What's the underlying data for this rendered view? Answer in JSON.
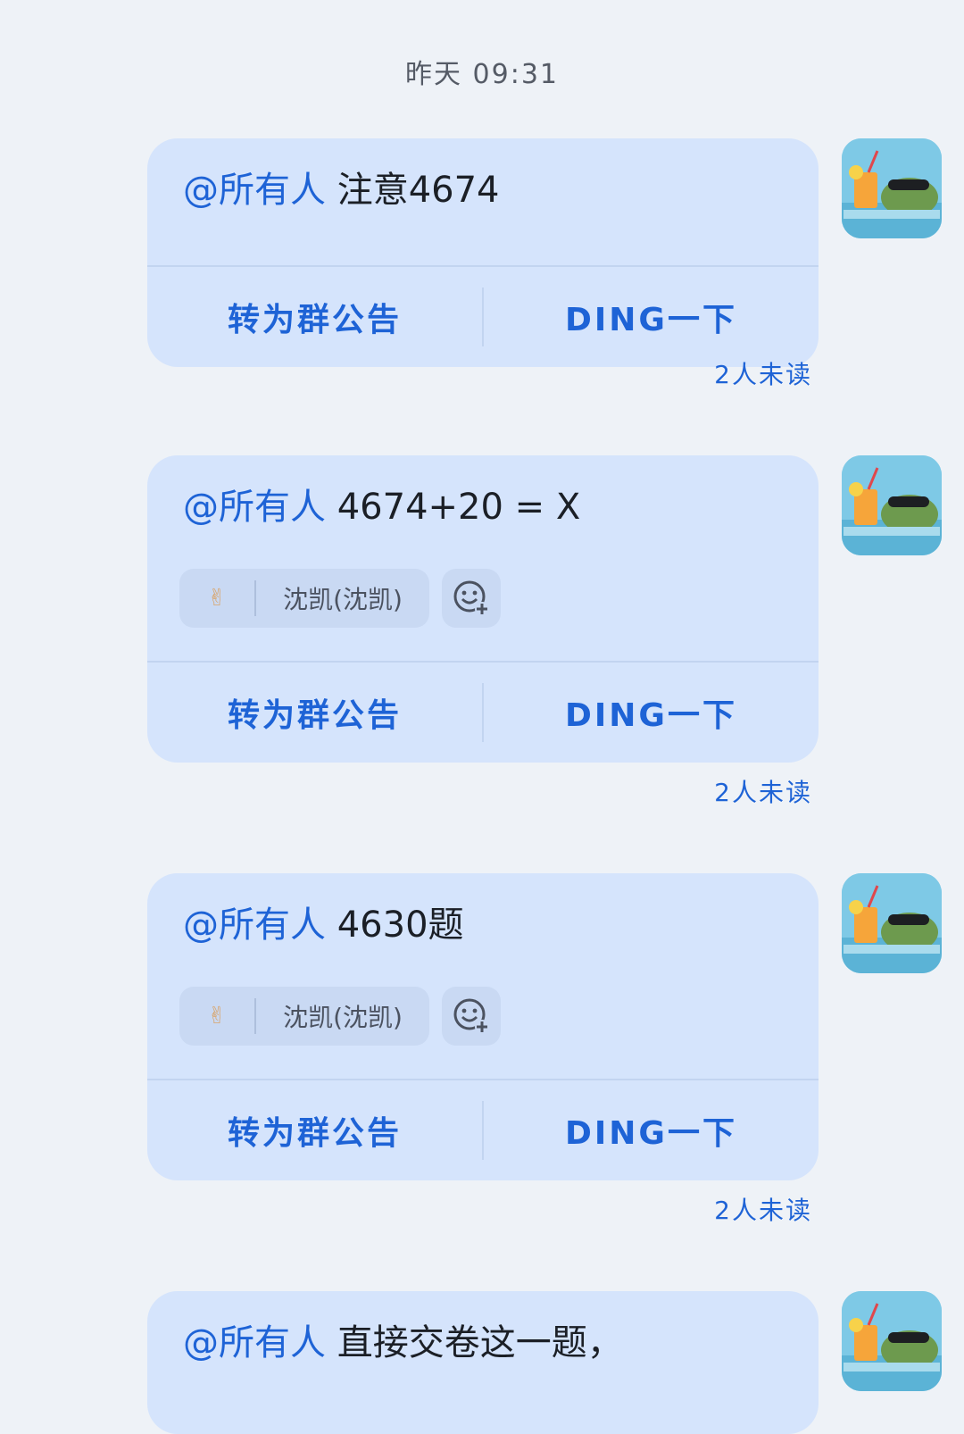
{
  "timestamp": "昨天 09:31",
  "messages": [
    {
      "mention": "@所有人",
      "text": " 注意4674",
      "actions": {
        "announce": "转为群公告",
        "ding": "DING一下"
      },
      "unread": "2人未读"
    },
    {
      "mention": "@所有人",
      "text": " 4674+20 = X",
      "reaction": {
        "emoji": "ok-hand-icon",
        "name": "沈凯(沈凯)"
      },
      "actions": {
        "announce": "转为群公告",
        "ding": "DING一下"
      },
      "unread": "2人未读"
    },
    {
      "mention": "@所有人",
      "text": " 4630题",
      "reaction": {
        "emoji": "ok-hand-icon",
        "name": "沈凯(沈凯)"
      },
      "actions": {
        "announce": "转为群公告",
        "ding": "DING一下"
      },
      "unread": "2人未读"
    },
    {
      "mention": "@所有人",
      "text": " 直接交卷这一题，"
    }
  ],
  "colors": {
    "background": "#eef2f7",
    "bubble": "#d5e4fc",
    "accent": "#1e63d6"
  }
}
